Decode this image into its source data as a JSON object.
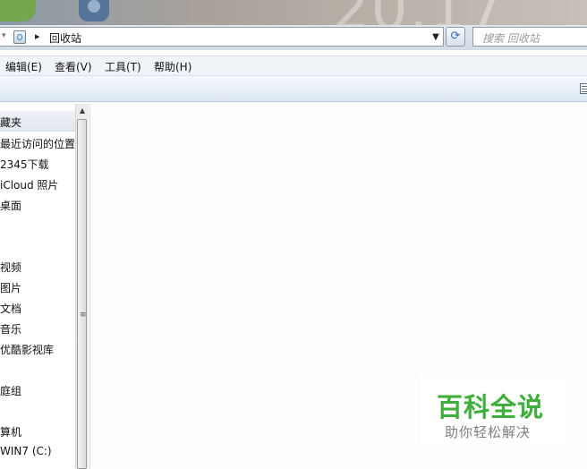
{
  "window": {
    "glass_watermark": "20.17"
  },
  "address_bar": {
    "location": "回收站",
    "refresh_glyph": "⟳"
  },
  "search": {
    "placeholder": "搜索 回收站"
  },
  "menu": {
    "items": [
      {
        "label": "编辑(E)"
      },
      {
        "label": "查看(V)"
      },
      {
        "label": "工具(T)"
      },
      {
        "label": "帮助(H)"
      }
    ]
  },
  "nav_pane": {
    "header": "藏夹",
    "items": [
      {
        "label": "最近访问的位置"
      },
      {
        "label": "2345下载"
      },
      {
        "label": "iCloud 照片"
      },
      {
        "label": "桌面"
      },
      {
        "label": "视频"
      },
      {
        "label": "图片"
      },
      {
        "label": "文档"
      },
      {
        "label": "音乐"
      },
      {
        "label": "优酷影视库"
      },
      {
        "label": "庭组"
      },
      {
        "label": "算机"
      },
      {
        "label": "WIN7 (C:)"
      }
    ]
  },
  "watermark": {
    "title": "百科全说",
    "subtitle": "助你轻松解决"
  },
  "colors": {
    "brand_green": "#3eaf3a",
    "address_icon_blue": "#2c8bd6"
  },
  "icons": [
    "recycle-bin-icon",
    "refresh-icon",
    "dropdown-arrow-icon",
    "view-options-icon",
    "scroll-up-icon"
  ]
}
